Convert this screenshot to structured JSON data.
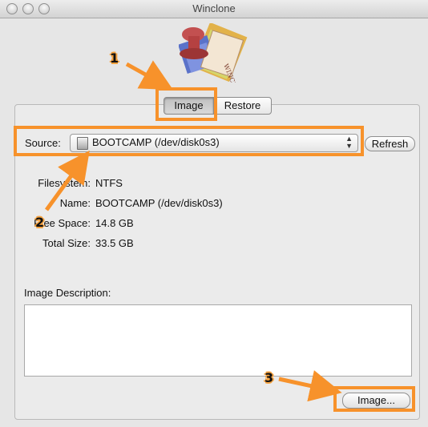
{
  "window": {
    "title": "Winclone"
  },
  "logo": {
    "icon": "winclone-stamp-icon",
    "text": "WINCLONE"
  },
  "tabs": [
    {
      "label": "Image",
      "selected": true
    },
    {
      "label": "Restore",
      "selected": false
    }
  ],
  "source": {
    "label": "Source:",
    "selected": "BOOTCAMP (/dev/disk0s3)",
    "refresh_label": "Refresh"
  },
  "info": {
    "filesystem": {
      "label": "Filesystem:",
      "value": "NTFS"
    },
    "name": {
      "label": "Name:",
      "value": "BOOTCAMP (/dev/disk0s3)"
    },
    "free_space": {
      "label": "Free Space:",
      "value": "14.8 GB"
    },
    "total_size": {
      "label": "Total Size:",
      "value": "33.5 GB"
    }
  },
  "description": {
    "label": "Image Description:",
    "value": ""
  },
  "action": {
    "image_button_label": "Image..."
  },
  "annotations": {
    "color": "#f7922b",
    "markers": [
      "1",
      "2",
      "3"
    ]
  }
}
